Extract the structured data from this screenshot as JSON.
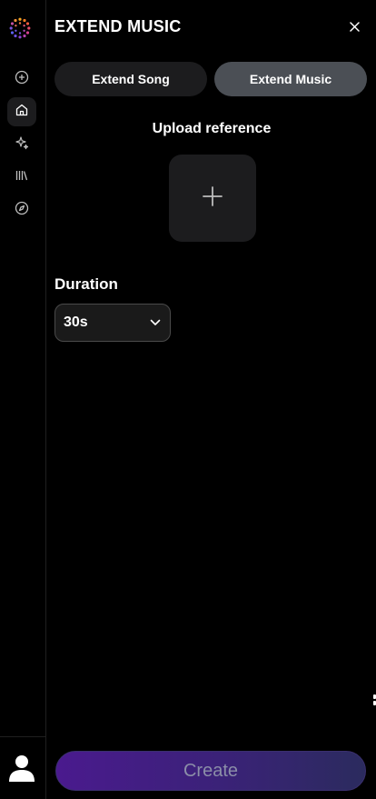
{
  "panel": {
    "title": "EXTEND MUSIC"
  },
  "tabs": [
    {
      "label": "Extend Song",
      "active": false
    },
    {
      "label": "Extend Music",
      "active": true
    }
  ],
  "upload": {
    "label": "Upload reference"
  },
  "duration": {
    "label": "Duration",
    "selected": "30s"
  },
  "create": {
    "label": "Create"
  },
  "sidebar": {
    "items": [
      {
        "icon": "plus-circle-icon"
      },
      {
        "icon": "home-icon",
        "active": true
      },
      {
        "icon": "sparkles-icon"
      },
      {
        "icon": "library-icon"
      },
      {
        "icon": "compass-icon"
      }
    ]
  },
  "colors": {
    "background": "#000000",
    "surface": "#1c1c1e",
    "active_tab": "#4b4f55",
    "create_gradient_start": "#4a1a8e",
    "create_gradient_end": "#2b2b5e"
  }
}
